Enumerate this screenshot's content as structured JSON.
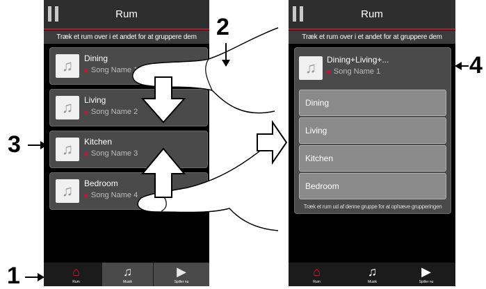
{
  "left_screen": {
    "title": "Rum",
    "hint": "Træk et rum over i et andet for at gruppere dem",
    "rooms": [
      {
        "name": "Dining",
        "song": "Song Name 1"
      },
      {
        "name": "Living",
        "song": "Song Name 2"
      },
      {
        "name": "Kitchen",
        "song": "Song Name 3"
      },
      {
        "name": "Bedroom",
        "song": "Song Name 4"
      }
    ]
  },
  "right_screen": {
    "title": "Rum",
    "hint": "Træk et rum over i et andet for at gruppere dem",
    "group": {
      "name": "Dining+Living+...",
      "song": "Song Name 1"
    },
    "group_items": [
      "Dining",
      "Living",
      "Kitchen",
      "Bedroom"
    ],
    "ungroup_hint": "Træk et rum ud af denne gruppe for at ophæve grupperingen"
  },
  "tabs": [
    {
      "label": "Rum",
      "icon": "house-icon"
    },
    {
      "label": "Musik",
      "icon": "music-note-icon"
    },
    {
      "label": "Spiller nu",
      "icon": "play-icon"
    }
  ],
  "callouts": {
    "one": "1",
    "two": "2",
    "three": "3",
    "four": "4"
  },
  "colors": {
    "accent": "#c8103c",
    "card": "#4a4a4a",
    "group_item": "#8a8a8a"
  }
}
